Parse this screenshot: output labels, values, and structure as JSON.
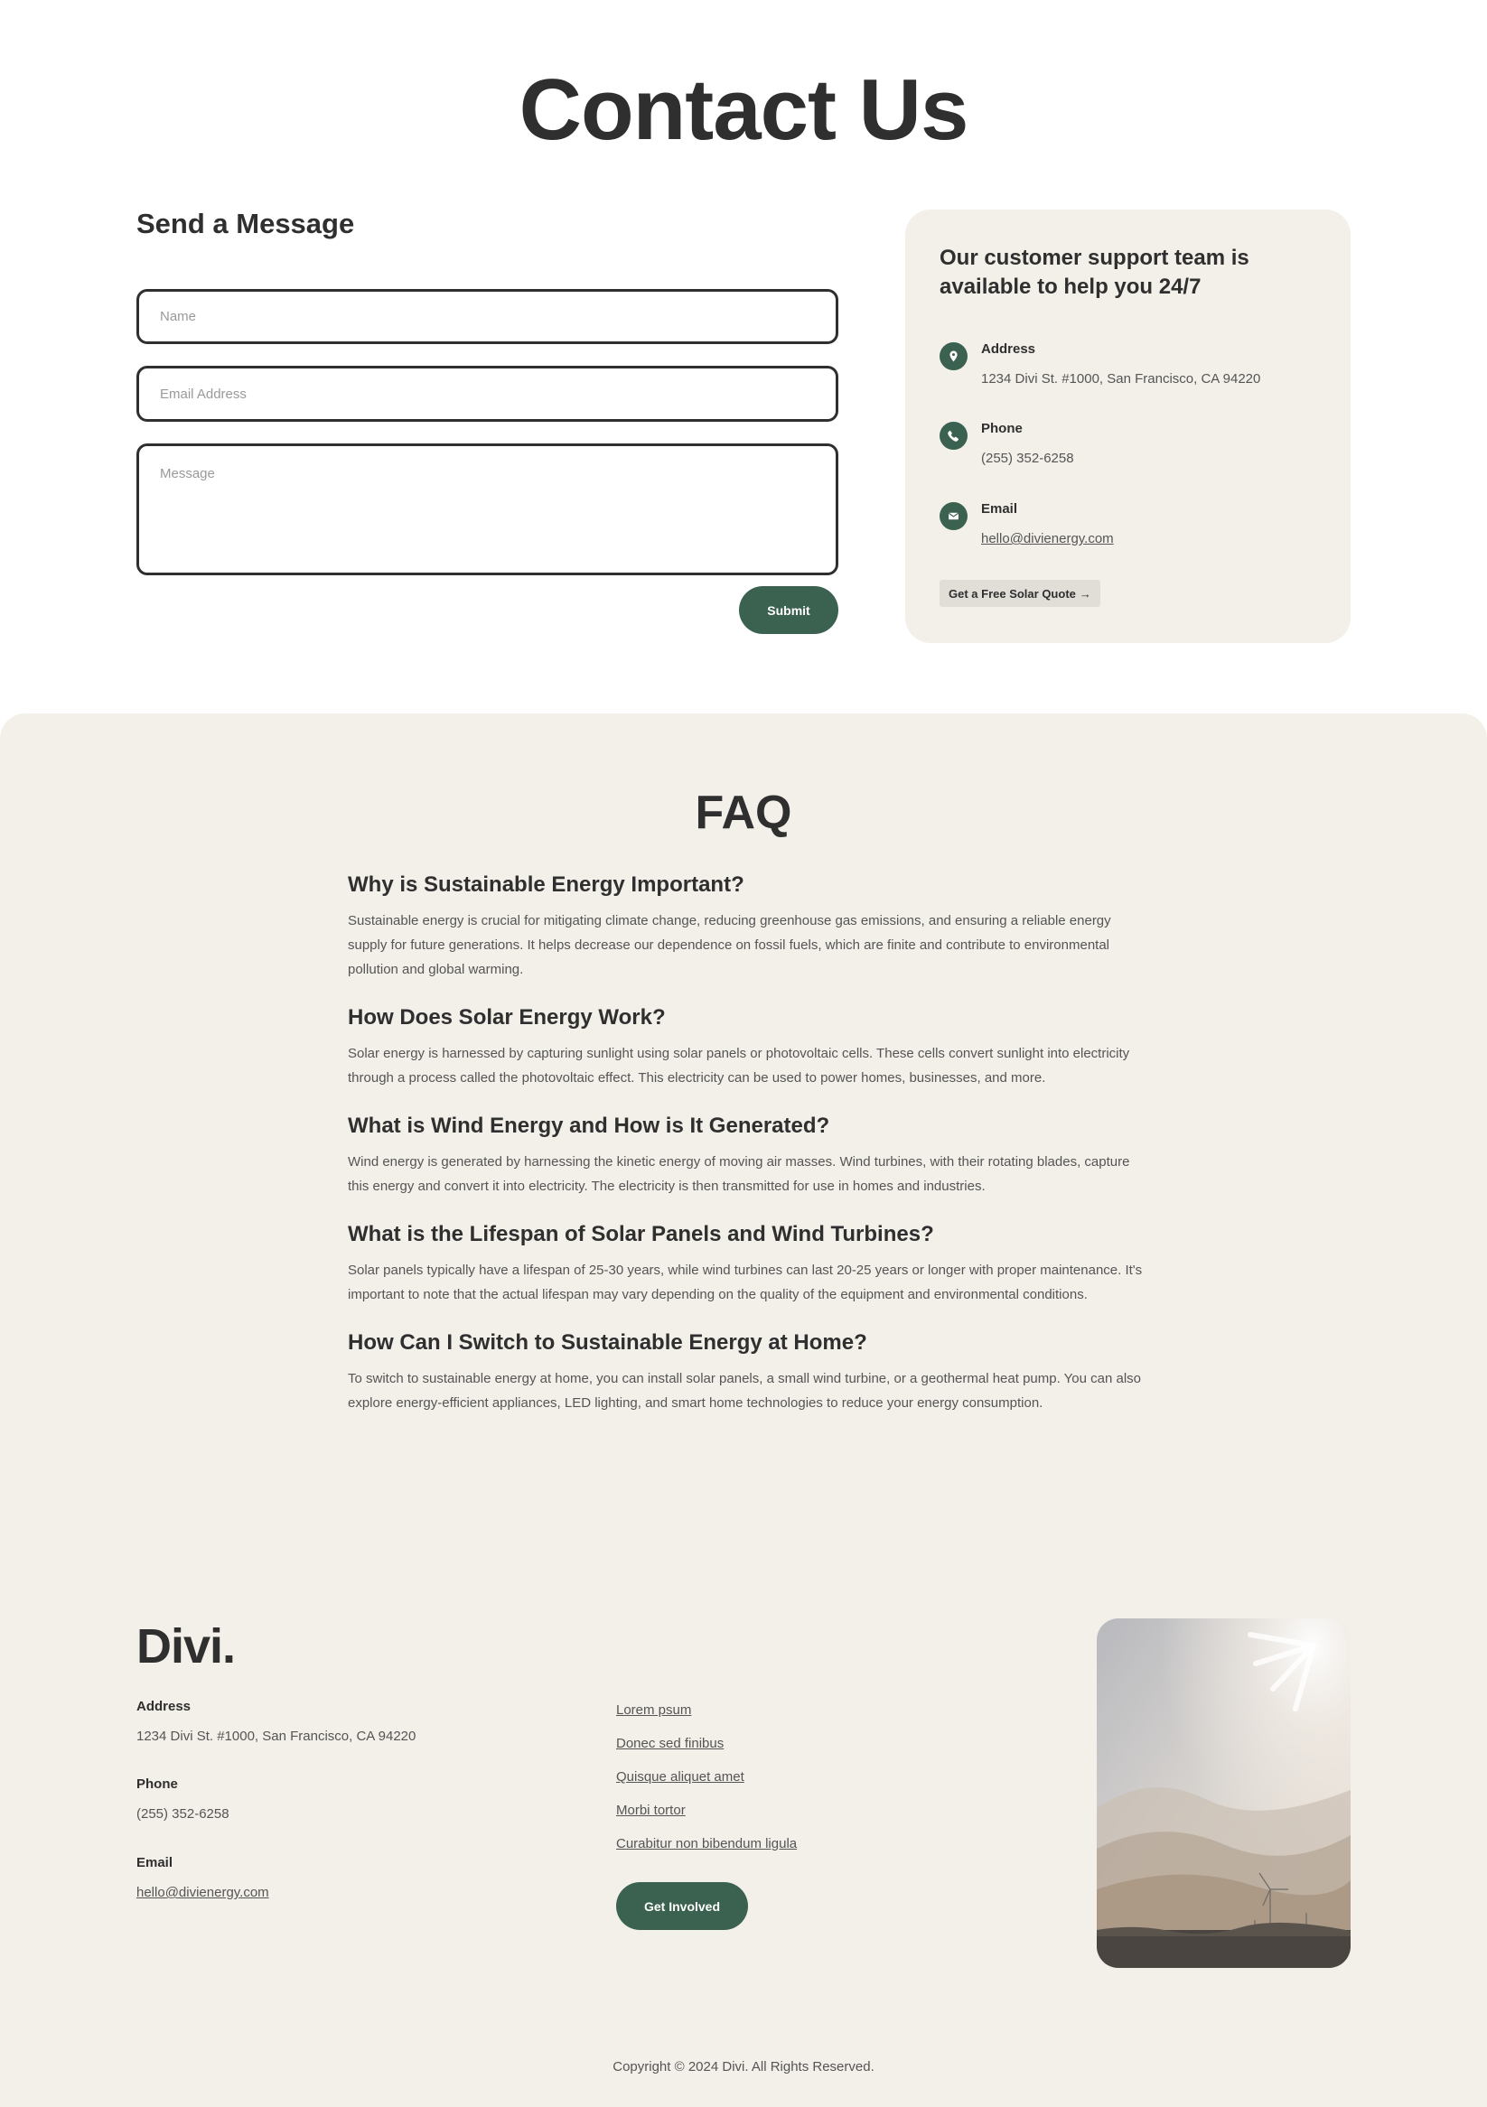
{
  "page": {
    "title": "Contact Us"
  },
  "form": {
    "heading": "Send a Message",
    "name_placeholder": "Name",
    "email_placeholder": "Email Address",
    "message_placeholder": "Message",
    "submit_label": "Submit"
  },
  "support": {
    "heading": "Our customer support team is available to help you 24/7",
    "address_label": "Address",
    "address_value": "1234 Divi St. #1000, San Francisco, CA 94220",
    "phone_label": "Phone",
    "phone_value": "(255) 352-6258",
    "email_label": "Email",
    "email_value": "hello@divienergy.com",
    "quote_button_label": "Get a Free Solar Quote",
    "quote_button_arrow": "→"
  },
  "faq": {
    "title": "FAQ",
    "items": [
      {
        "question": "Why is Sustainable Energy Important?",
        "answer": "Sustainable energy is crucial for mitigating climate change, reducing greenhouse gas emissions, and ensuring a reliable energy supply for future generations. It helps decrease our dependence on fossil fuels, which are finite and contribute to environmental pollution and global warming."
      },
      {
        "question": "How Does Solar Energy Work?",
        "answer": "Solar energy is harnessed by capturing sunlight using solar panels or photovoltaic cells. These cells convert sunlight into electricity through a process called the photovoltaic effect. This electricity can be used to power homes, businesses, and more."
      },
      {
        "question": "What is Wind Energy and How is It Generated?",
        "answer": "Wind energy is generated by harnessing the kinetic energy of moving air masses. Wind turbines, with their rotating blades, capture this energy and convert it into electricity. The electricity is then transmitted for use in homes and industries."
      },
      {
        "question": "What is the Lifespan of Solar Panels and Wind Turbines?",
        "answer": "Solar panels typically have a lifespan of 25-30 years, while wind turbines can last 20-25 years or longer with proper maintenance. It's important to note that the actual lifespan may vary depending on the quality of the equipment and environmental conditions."
      },
      {
        "question": "How Can I Switch to Sustainable Energy at Home?",
        "answer": "To switch to sustainable energy at home, you can install solar panels, a small wind turbine, or a geothermal heat pump. You can also explore energy-efficient appliances, LED lighting, and smart home technologies to reduce your energy consumption."
      }
    ]
  },
  "footer": {
    "logo": "Divi.",
    "address_label": "Address",
    "address_value": "1234 Divi St. #1000, San Francisco, CA 94220",
    "phone_label": "Phone",
    "phone_value": "(255) 352-6258",
    "email_label": "Email",
    "email_value": "hello@divienergy.com",
    "links": [
      "Lorem psum",
      "Donec sed finibus",
      "Quisque aliquet amet",
      "Morbi tortor",
      "Curabitur non bibendum ligula"
    ],
    "cta_label": "Get Involved",
    "copyright": "Copyright © 2024 Divi. All Rights Reserved."
  },
  "colors": {
    "accent": "#3b6150",
    "band": "#f3efe9",
    "text": "#2f2f2f"
  }
}
